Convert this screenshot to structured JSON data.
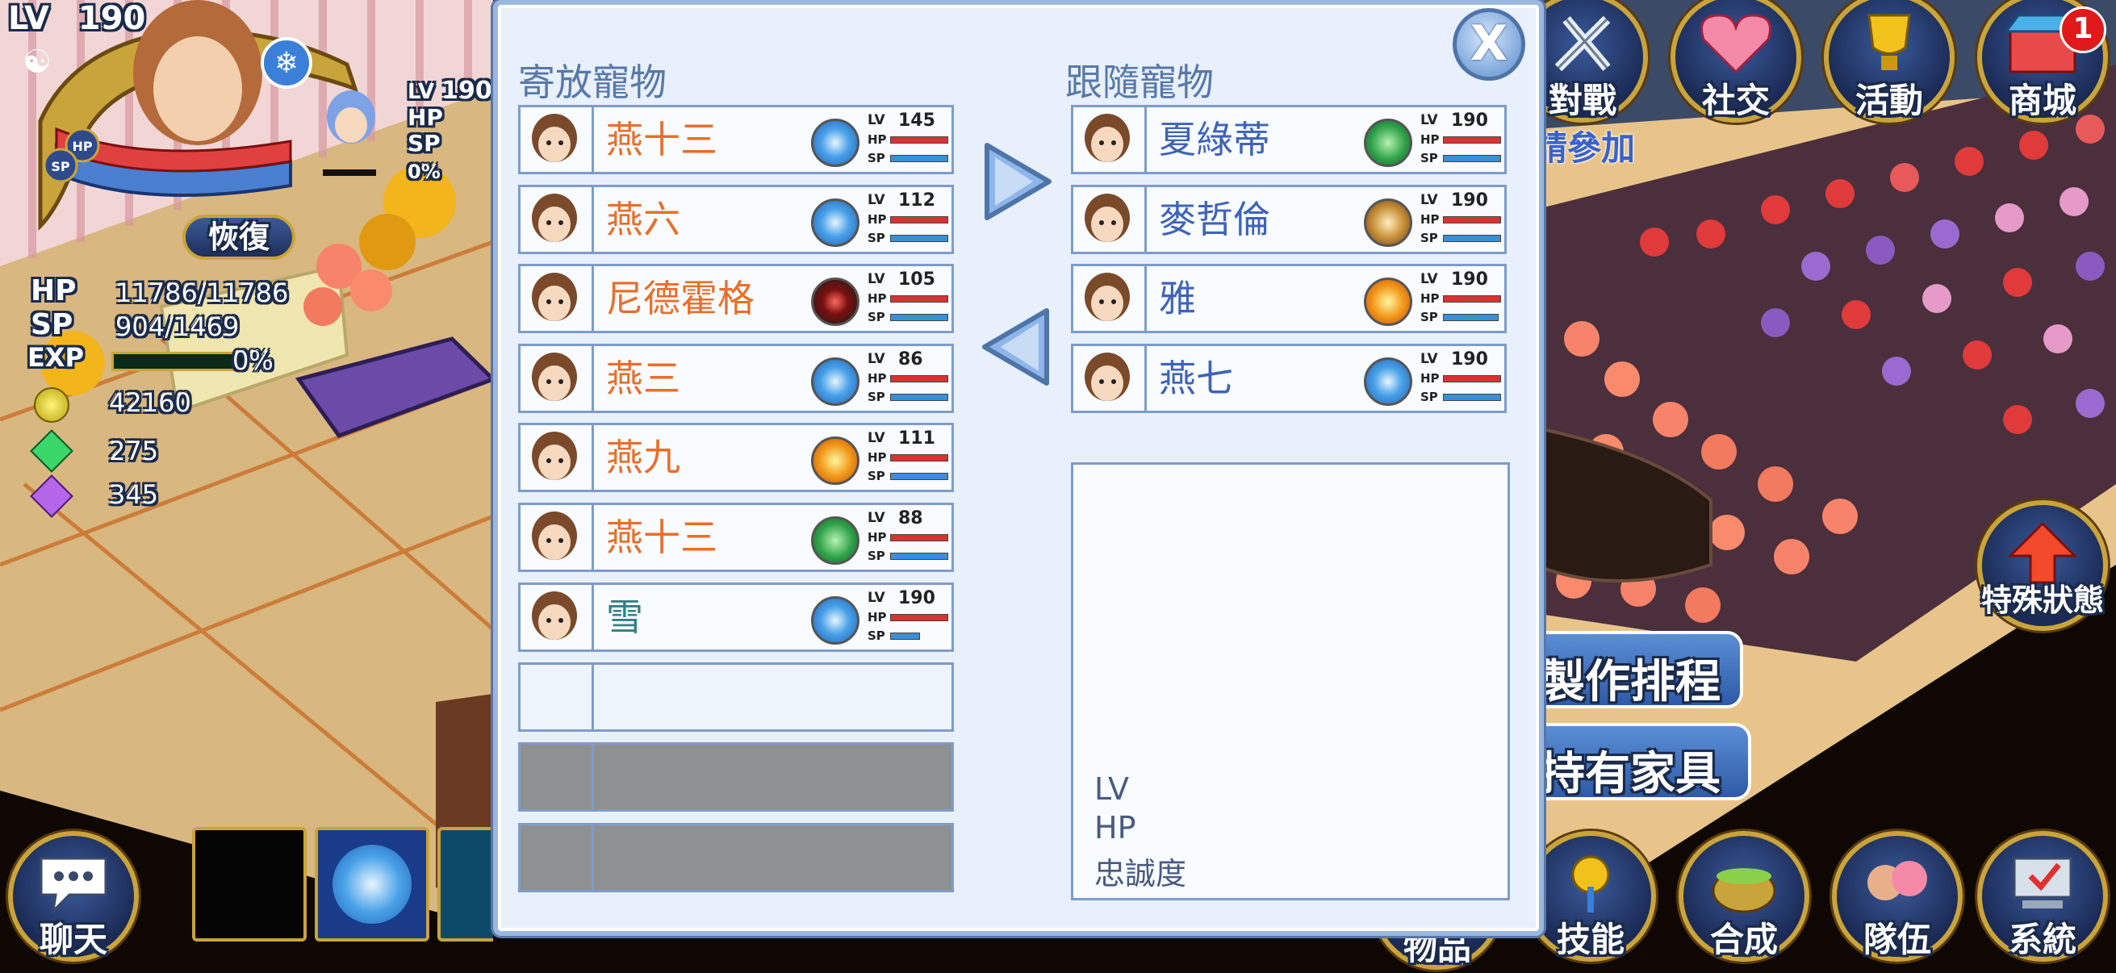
{
  "player": {
    "level_label": "LV",
    "level": "190",
    "restore_label": "恢復",
    "hp_label": "HP",
    "hp_value": "11786/11786",
    "sp_label": "SP",
    "sp_value": "904/1469",
    "exp_label": "EXP",
    "exp_percent": "0%",
    "gold": "42160",
    "green_gems": "275",
    "purple_gems": "345"
  },
  "pet_mini": {
    "level_label": "LV",
    "level": "190",
    "hp_label": "HP",
    "sp_label": "SP",
    "exp_percent": "0%"
  },
  "top_menu": {
    "battle": "對戰",
    "social": "社交",
    "events": "活動",
    "shop": "商城",
    "shop_badge": "1",
    "join_text": "請參加"
  },
  "side_buttons": {
    "special_status": "特殊狀態",
    "craft_schedule": "製作排程",
    "owned_furniture": "持有家具"
  },
  "bottom_menu": {
    "chat": "聊天",
    "items": "物品",
    "skills": "技能",
    "compose": "合成",
    "team": "隊伍",
    "system": "系統"
  },
  "dialog": {
    "left_title": "寄放寵物",
    "right_title": "跟隨寵物",
    "close_label": "X",
    "stored_pets": [
      {
        "name": "燕十三",
        "level": "145",
        "element": "ice",
        "hp_fill": 1.0,
        "sp_fill": 1.0,
        "name_color": "#ea6e2a"
      },
      {
        "name": "燕六",
        "level": "112",
        "element": "ice",
        "hp_fill": 1.0,
        "sp_fill": 1.0,
        "name_color": "#ea6e2a"
      },
      {
        "name": "尼德霍格",
        "level": "105",
        "element": "dark",
        "hp_fill": 1.0,
        "sp_fill": 1.0,
        "name_color": "#ea6e2a"
      },
      {
        "name": "燕三",
        "level": "86",
        "element": "ice",
        "hp_fill": 1.0,
        "sp_fill": 1.0,
        "name_color": "#ea6e2a"
      },
      {
        "name": "燕九",
        "level": "111",
        "element": "fire",
        "hp_fill": 1.0,
        "sp_fill": 1.0,
        "name_color": "#ea6e2a"
      },
      {
        "name": "燕十三",
        "level": "88",
        "element": "wind",
        "hp_fill": 1.0,
        "sp_fill": 1.0,
        "name_color": "#ea6e2a"
      },
      {
        "name": "雪",
        "level": "190",
        "element": "ice",
        "hp_fill": 1.0,
        "sp_fill": 0.5,
        "name_color": "#357f86"
      }
    ],
    "following_pets": [
      {
        "name": "夏綠蒂",
        "level": "190",
        "element": "wind",
        "hp_fill": 1.0,
        "sp_fill": 1.0,
        "name_color": "#3f63b7"
      },
      {
        "name": "麥哲倫",
        "level": "190",
        "element": "earth",
        "hp_fill": 1.0,
        "sp_fill": 1.0,
        "name_color": "#3f63b7"
      },
      {
        "name": "雅",
        "level": "190",
        "element": "fire",
        "hp_fill": 1.0,
        "sp_fill": 0.95,
        "name_color": "#3f63b7"
      },
      {
        "name": "燕七",
        "level": "190",
        "element": "ice",
        "hp_fill": 1.0,
        "sp_fill": 1.0,
        "name_color": "#3f63b7"
      }
    ],
    "stat_lv": "LV",
    "stat_hp": "HP",
    "stat_sp": "SP",
    "info": {
      "lv_label": "LV",
      "hp_label": "HP",
      "loyalty_label": "忠誠度"
    }
  },
  "colors": {
    "dialog_bg": "#e8f0fb",
    "dialog_border": "#9ab8de",
    "title_color": "#5878a8",
    "stored_name": "#ea6e2a",
    "following_name": "#3f63b7"
  }
}
